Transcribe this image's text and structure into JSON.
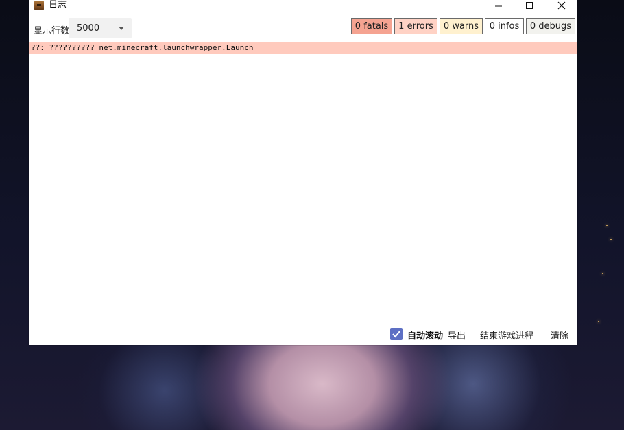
{
  "window": {
    "title": "日志",
    "controls": {
      "minimize": "minimize-icon",
      "maximize": "maximize-icon",
      "close": "close-icon"
    }
  },
  "toolbar": {
    "lines_label": "显示行数",
    "lines_value": "5000",
    "filters": [
      {
        "label": "0 fatals",
        "color": "#f5a391"
      },
      {
        "label": "1 errors",
        "color": "#ffd2c5"
      },
      {
        "label": "0 warns",
        "color": "#fff1cf"
      },
      {
        "label": "0 infos",
        "color": "#ffffff"
      },
      {
        "label": "0 debugs",
        "color": "#f2f2ee"
      }
    ]
  },
  "log": {
    "lines": [
      {
        "text": "??: ?????????? net.minecraft.launchwrapper.Launch",
        "level": "error",
        "color": "#ffcabd"
      }
    ]
  },
  "footer": {
    "auto_scroll_label": "自动滚动",
    "auto_scroll_checked": true,
    "export_label": "导出",
    "kill_label": "结束游戏进程",
    "clear_label": "清除"
  },
  "colors": {
    "accent": "#5d6fc4"
  }
}
